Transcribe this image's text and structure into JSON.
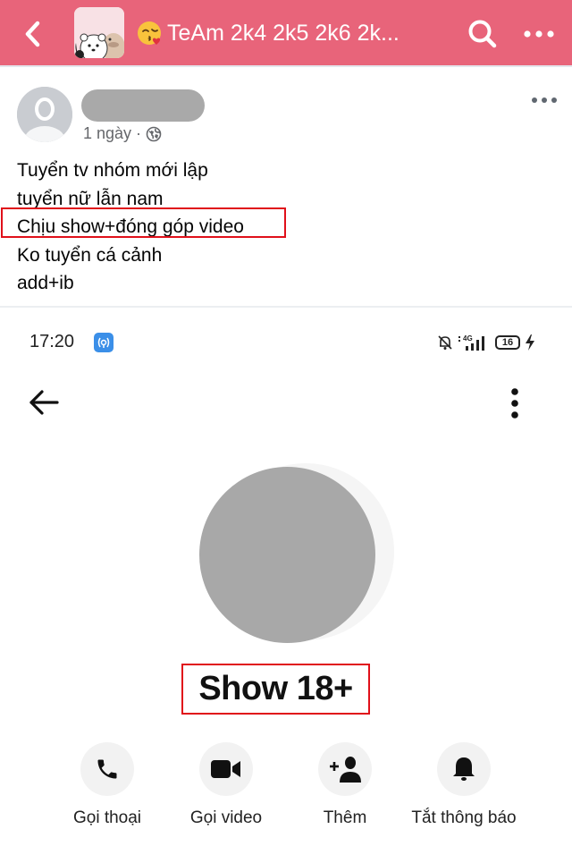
{
  "topbar": {
    "group_title": "TeAm 2k4 2k5 2k6 2k...",
    "group_emoji": "kissing-face-with-heart",
    "back_icon": "chevron-left-icon",
    "search_icon": "search-icon",
    "more_icon": "more-horizontal-icon",
    "background_color": "#e8647a"
  },
  "post": {
    "author_name": "",
    "time": "1 ngày",
    "separator": "·",
    "privacy_icon": "globe-icon",
    "lines": [
      "Tuyển tv nhóm mới lập",
      "tuyển nữ lẫn nam",
      "Chịu show+đóng góp video",
      "Ko tuyển cá cảnh",
      "add+ib"
    ],
    "highlighted_line_index": 2
  },
  "embedded_screenshot": {
    "status_bar": {
      "time": "17:20",
      "network": "4G",
      "battery": "16"
    },
    "profile_name": "Show 18+",
    "actions": [
      {
        "label": "Gọi thoại",
        "icon": "phone-icon"
      },
      {
        "label": "Gọi video",
        "icon": "video-camera-icon"
      },
      {
        "label": "Thêm",
        "icon": "add-person-icon"
      },
      {
        "label": "Tắt thông báo",
        "icon": "bell-icon"
      }
    ]
  },
  "colors": {
    "highlight_border": "#e0101a",
    "blur_placeholder": "#a9a9a9"
  }
}
